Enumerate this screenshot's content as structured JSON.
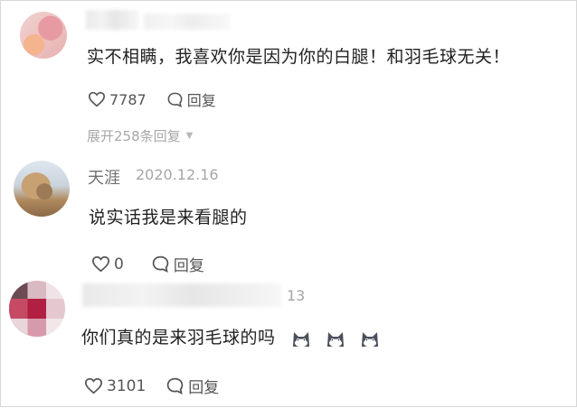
{
  "comments": [
    {
      "name": "",
      "text": "实不相瞒，我喜欢你是因为你的白腿！和羽毛球无关！",
      "likes": "7787",
      "reply_label": "回复",
      "expand_label": "展开258条回复"
    },
    {
      "name": "天涯",
      "date": "2020.12.16",
      "text": "说实话我是来看腿的",
      "likes": "0",
      "reply_label": "回复"
    },
    {
      "name": "",
      "date_fragment": "13",
      "text": "你们真的是来羽毛球的吗",
      "emojis": [
        "cat-emoji-icon",
        "cat-emoji-icon",
        "cat-emoji-icon"
      ],
      "likes": "3101",
      "reply_label": "回复"
    }
  ],
  "colors": {
    "text": "#222222",
    "meta": "#a6a6a6",
    "action": "#555555"
  }
}
